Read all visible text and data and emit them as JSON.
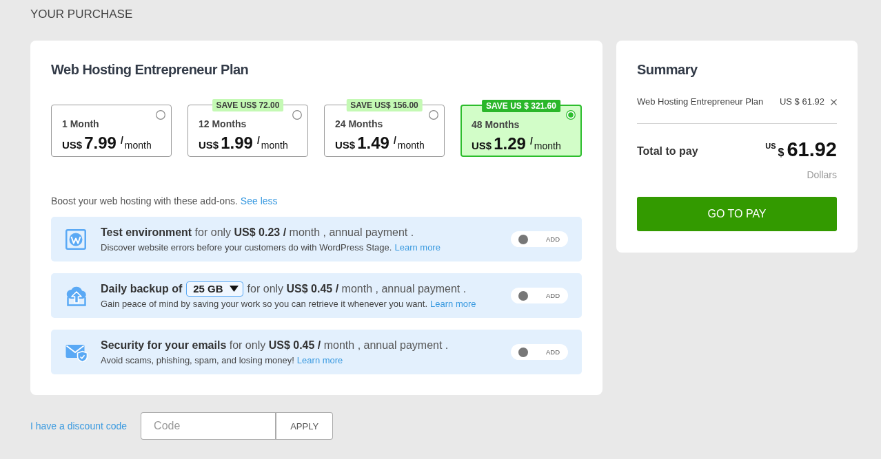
{
  "page_title": "YOUR PURCHASE",
  "plan": {
    "title": "Web Hosting Entrepreneur Plan",
    "periods": [
      {
        "label": "1 Month",
        "currency": "US$",
        "amount": "7.99",
        "slash": "/",
        "unit": "month",
        "selected": false
      },
      {
        "label": "12 Months",
        "save": "SAVE US$ 72.00",
        "currency": "US$",
        "amount": "1.99",
        "slash": "/",
        "unit": "month",
        "selected": false
      },
      {
        "label": "24 Months",
        "save": "SAVE US$ 156.00",
        "currency": "US$",
        "amount": "1.49",
        "slash": "/",
        "unit": "month",
        "selected": false
      },
      {
        "label": "48 Months",
        "save": "SAVE US $ 321.60",
        "currency": "US$",
        "amount": "1.29",
        "slash": "/",
        "unit": "month",
        "selected": true
      }
    ],
    "addons_intro": "Boost your web hosting with these add-ons.",
    "addons_link": "See less",
    "addons": [
      {
        "kind": "staging",
        "headline": [
          {
            "kind": "text",
            "text": "**Test environment** for only **US$ 0.23 /** month , annual payment ."
          }
        ],
        "description": "Discover website errors before your customers do with WordPress Stage.",
        "link": "Learn more",
        "toggle": {
          "label": "ADD",
          "on": false
        }
      },
      {
        "kind": "backup",
        "headline": [
          {
            "kind": "name",
            "text": "Daily backup of"
          },
          {
            "kind": "select",
            "value": "25 GB"
          },
          {
            "kind": "text",
            "text": "for only **US$ 0.45 /** month , annual payment ."
          }
        ],
        "description": "Gain peace of mind by saving your work so you can retrieve it whenever you want.",
        "link": "Learn more",
        "toggle": {
          "label": "ADD",
          "on": false
        }
      },
      {
        "kind": "email",
        "headline": [
          {
            "kind": "text",
            "text": "**Security for your emails** for only **US$ 0.45 /** month , annual payment ."
          }
        ],
        "description": "Avoid scams, phishing, spam, and losing money!",
        "link": "Learn more",
        "toggle": {
          "label": "ADD",
          "on": false
        }
      }
    ]
  },
  "summary": {
    "title": "Summary",
    "items": [
      {
        "name": "Web Hosting Entrepreneur Plan",
        "price": "US $ 61.92"
      }
    ],
    "total_label": "Total to pay",
    "total": {
      "prefix": "US",
      "symbol": "$",
      "amount": "61.92",
      "unit": "Dollars"
    },
    "pay_button": "GO TO PAY"
  },
  "discount": {
    "link": "I have a discount code",
    "placeholder": "Code",
    "button": "APPLY"
  }
}
